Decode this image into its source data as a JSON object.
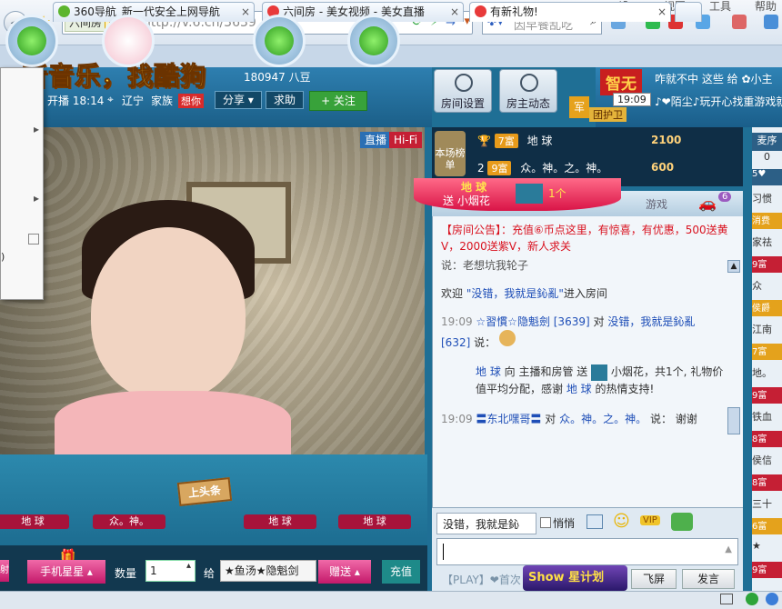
{
  "browser": {
    "address_site": "六间房",
    "address_badge": "证",
    "url": "http://v.6.cn/3639",
    "search_text": "因早餐乱吃",
    "top_menu": [
      "优",
      "设",
      "视图",
      "工具",
      "帮助"
    ]
  },
  "tabs": [
    {
      "label": "360导航_新一代安全上网导航",
      "close": "×"
    },
    {
      "label": "六间房 - 美女视频 - 美女直播",
      "close": "×"
    },
    {
      "label": "有新礼物!",
      "close": "×"
    }
  ],
  "banner": {
    "text": "听音乐，找酷狗"
  },
  "room": {
    "fans_count": "180947 八豆",
    "start_label": "开播 18:14",
    "location": "辽宁",
    "family_label": "家族",
    "family_badge": "想你",
    "share_label": "分享",
    "help_label": "求助",
    "follow_label": "+ 关注",
    "room_settings_label": "房间设置",
    "host_updates_label": "房主动态",
    "guard_label": "团护卫",
    "guard_badge": "军",
    "host_name_tag": "智无"
  },
  "top_marquee": {
    "line1": "咋就不中 这些 给 ✿小主",
    "time": "19:09",
    "line2": "♪❤陌尘♪玩开心找重游戏就"
  },
  "video": {
    "live_badge": "直播",
    "hifi_badge": "Hi-Fi"
  },
  "fans": [
    {
      "name": "地 球"
    },
    {
      "name": "众。神。"
    },
    {
      "name": "地 球"
    },
    {
      "name": "地 球"
    }
  ],
  "toutiao_label": "上头条",
  "gift_bar": {
    "left_badge": "射",
    "gift_name": "手机星星",
    "qty_label": "数量",
    "qty_value": "1",
    "to_label": "给",
    "to_value": "★鱼汤★隐魁剑",
    "send_label": "赠送",
    "recharge_label": "充值"
  },
  "rank": {
    "board_label": "本场榜单",
    "rows": [
      {
        "rank": "",
        "level": "7富",
        "name": "地 球",
        "coins": "2100"
      },
      {
        "rank": "2",
        "level": "9富",
        "name": "众。神。之。神。",
        "coins": "600"
      }
    ]
  },
  "notification": {
    "title": "地 球",
    "action": "送 小烟花",
    "count": "1个"
  },
  "chat_tabs": {
    "game": "游戏",
    "badge": "6"
  },
  "chat": {
    "announcement_label": "【房间公告】：",
    "announcement_text": "充值⑥币点这里，有惊喜，有优惠，500送黄V，2000送紫V，新人求关",
    "say_prefix": "说：",
    "say1": "老想坑我轮子",
    "welcome_prefix": "欢迎 ",
    "welcome_name": "\"没错，我就是鈊亂\"",
    "welcome_suffix": "进入房间",
    "msg2_time": "19:09",
    "msg2_from": "☆習慣☆隐魁劍 [3639]",
    "msg2_to": "对",
    "msg2_target": "没错，我就是鈊亂",
    "msg2_id": "[632]",
    "gift_from": "地 球",
    "gift_text_a": " 向 主播和房管 送 ",
    "gift_item": "小烟花",
    "gift_text_b": "，共1个, 礼物价值平均分配，感谢 ",
    "gift_thanks_name": "地 球",
    "gift_text_c": " 的热情支持!",
    "msg3_time": "19:09",
    "msg3_from": "〓东北嘿哥〓",
    "msg3_to": "对",
    "msg3_target": "众。神。之。神。",
    "msg3_say": "说：",
    "msg3_text": "谢谢"
  },
  "chat_input": {
    "target": "没错，我就是鈊",
    "private_label": "悄悄",
    "play_label": "【PLAY】❤首次",
    "show_label": "Show",
    "star_plan": "星计划",
    "fly_label": "飞屏",
    "send_label": "发言"
  },
  "right_list": {
    "header": "麦序",
    "count": "0",
    "items": [
      "5♥",
      "习惯",
      "消费",
      "家祛",
      "9富",
      "众",
      "侯爵",
      "江南",
      "7富",
      "地。",
      "9富",
      "铁血",
      "8富",
      "侯信",
      "8富",
      "三十",
      "6富",
      "★",
      "9富"
    ]
  },
  "colors": {
    "accent": "#1f6f95",
    "pink": "#e0357b",
    "follow_green": "#38a23a"
  }
}
